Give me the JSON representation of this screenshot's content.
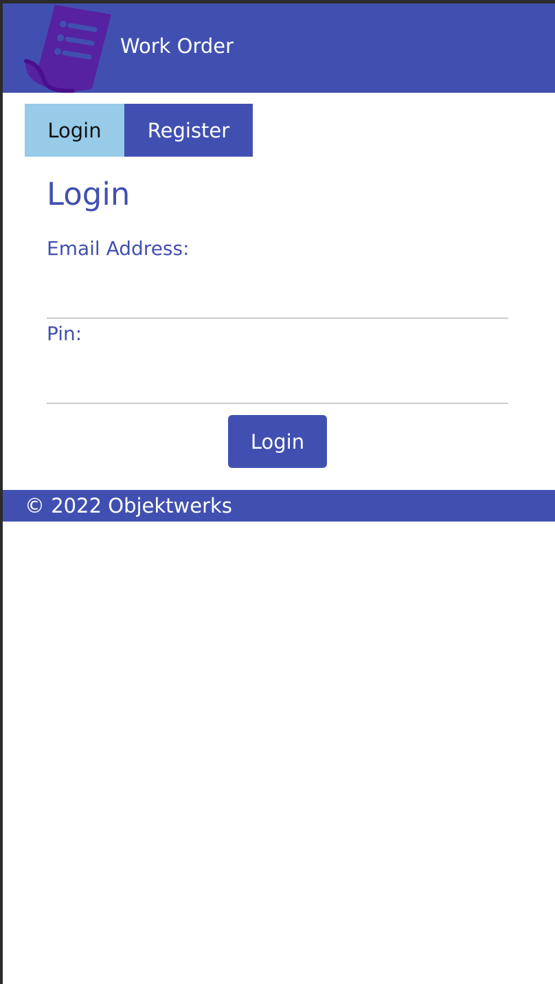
{
  "header": {
    "app_title": "Work Order",
    "logo_icon": "document-list-icon"
  },
  "tabs": [
    {
      "label": "Login",
      "active": true
    },
    {
      "label": "Register",
      "active": false
    }
  ],
  "form": {
    "title": "Login",
    "email_label": "Email Address:",
    "email_value": "",
    "pin_label": "Pin:",
    "pin_value": "",
    "submit_label": "Login"
  },
  "footer": {
    "text": "© 2022 Objektwerks"
  },
  "colors": {
    "primary": "#4150b0",
    "active_tab": "#97cbe8",
    "logo": "#5a1aa0",
    "background": "#ffffff"
  }
}
